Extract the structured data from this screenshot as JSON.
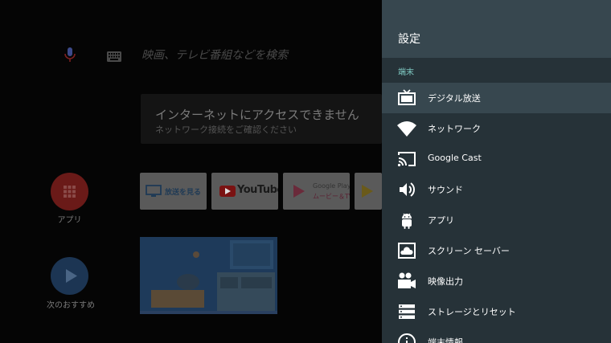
{
  "launcher": {
    "search_placeholder": "映画、テレビ番組などを検索",
    "notice": {
      "title": "インターネットにアクセスできません",
      "subtitle": "ネットワーク接続をご確認ください"
    },
    "apps_label": "アプリ",
    "next_label": "次のおすすめ",
    "tiles": {
      "broadcast": "放送を見る",
      "youtube": "YouTube",
      "play_line1": "Google Play",
      "play_line2": "ムービー＆TV"
    }
  },
  "settings": {
    "title": "設定",
    "section": "端末",
    "items": [
      {
        "label": "デジタル放送",
        "icon": "tv-icon"
      },
      {
        "label": "ネットワーク",
        "icon": "wifi-icon"
      },
      {
        "label": "Google Cast",
        "icon": "cast-icon"
      },
      {
        "label": "サウンド",
        "icon": "volume-icon"
      },
      {
        "label": "アプリ",
        "icon": "android-icon"
      },
      {
        "label": "スクリーン セーバー",
        "icon": "screensaver-icon"
      },
      {
        "label": "映像出力",
        "icon": "video-camera-icon"
      },
      {
        "label": "ストレージとリセット",
        "icon": "storage-icon"
      },
      {
        "label": "端末情報",
        "icon": "info-icon"
      }
    ]
  },
  "colors": {
    "panel_bg": "#263238",
    "header_bg": "#37474f",
    "section_accent": "#80cbc4",
    "selected_bg": "#37474f"
  }
}
